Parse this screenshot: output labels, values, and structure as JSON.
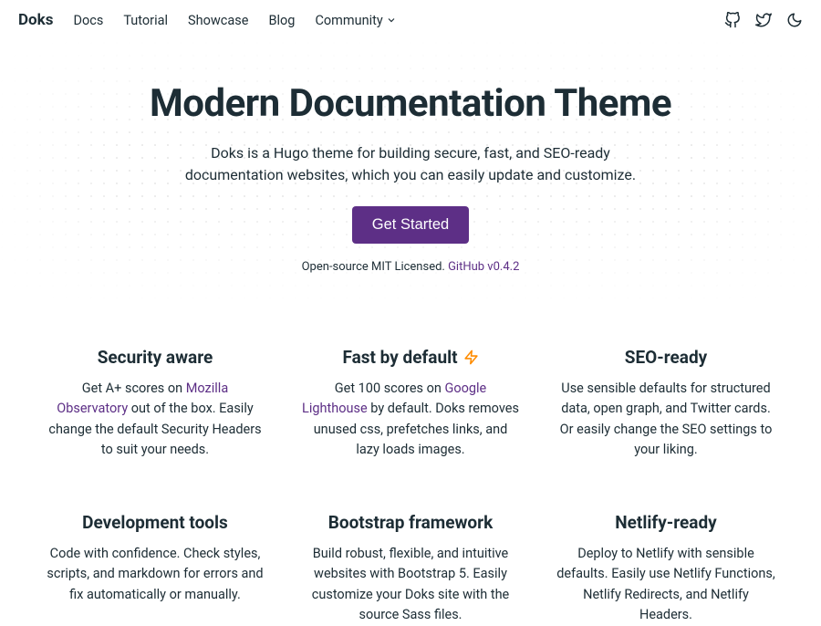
{
  "nav": {
    "brand": "Doks",
    "items": [
      "Docs",
      "Tutorial",
      "Showcase",
      "Blog",
      "Community"
    ]
  },
  "hero": {
    "title": "Modern Documentation Theme",
    "subtitle": "Doks is a Hugo theme for building secure, fast, and SEO-ready documentation websites, which you can easily update and customize.",
    "cta": "Get Started",
    "license_prefix": "Open-source MIT Licensed. ",
    "license_link": "GitHub v0.4.2"
  },
  "features": [
    {
      "title": "Security aware",
      "desc_pre": "Get A+ scores on ",
      "link": "Mozilla Observatory",
      "desc_post": " out of the box. Easily change the default Security Headers to suit your needs."
    },
    {
      "title": "Fast by default",
      "desc_pre": "Get 100 scores on ",
      "link": "Google Lighthouse",
      "desc_post": " by default. Doks removes unused css, prefetches links, and lazy loads images.",
      "bolt": true
    },
    {
      "title": "SEO-ready",
      "desc_pre": "Use sensible defaults for structured data, open graph, and Twitter cards. Or easily change the SEO settings to your liking.",
      "link": "",
      "desc_post": ""
    },
    {
      "title": "Development tools",
      "desc_pre": "Code with confidence. Check styles, scripts, and markdown for errors and fix automatically or manually.",
      "link": "",
      "desc_post": ""
    },
    {
      "title": "Bootstrap framework",
      "desc_pre": "Build robust, flexible, and intuitive websites with Bootstrap 5. Easily customize your Doks site with the source Sass files.",
      "link": "",
      "desc_post": ""
    },
    {
      "title": "Netlify-ready",
      "desc_pre": "Deploy to Netlify with sensible defaults. Easily use Netlify Functions, Netlify Redirects, and Netlify Headers.",
      "link": "",
      "desc_post": ""
    }
  ]
}
